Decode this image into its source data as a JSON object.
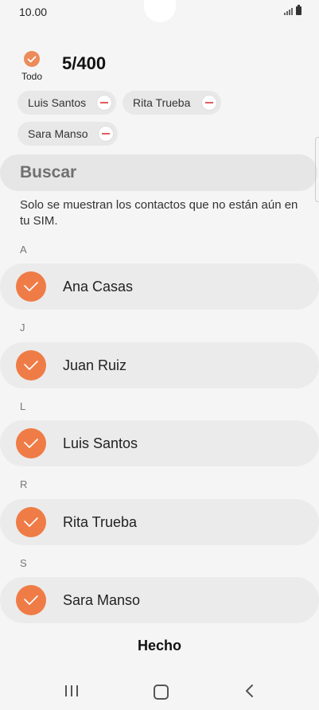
{
  "status_bar": {
    "time": "10.00"
  },
  "header": {
    "select_all_label": "Todo",
    "count": "5/400"
  },
  "selected_chips": [
    {
      "label": "Luis Santos"
    },
    {
      "label": "Rita Trueba"
    },
    {
      "label": "Sara Manso"
    }
  ],
  "search": {
    "placeholder": "Buscar"
  },
  "info_text": "Solo se muestran los contactos que no están aún en tu SIM.",
  "sections": [
    {
      "letter": "A",
      "contact": "Ana Casas",
      "checked": true
    },
    {
      "letter": "J",
      "contact": "Juan Ruiz",
      "checked": true
    },
    {
      "letter": "L",
      "contact": "Luis Santos",
      "checked": true
    },
    {
      "letter": "R",
      "contact": "Rita Trueba",
      "checked": true
    },
    {
      "letter": "S",
      "contact": "Sara Manso",
      "checked": true
    }
  ],
  "footer": {
    "done_label": "Hecho"
  },
  "colors": {
    "accent": "#ef7c46",
    "background": "#f5f5f5",
    "row": "#ebebeb"
  }
}
